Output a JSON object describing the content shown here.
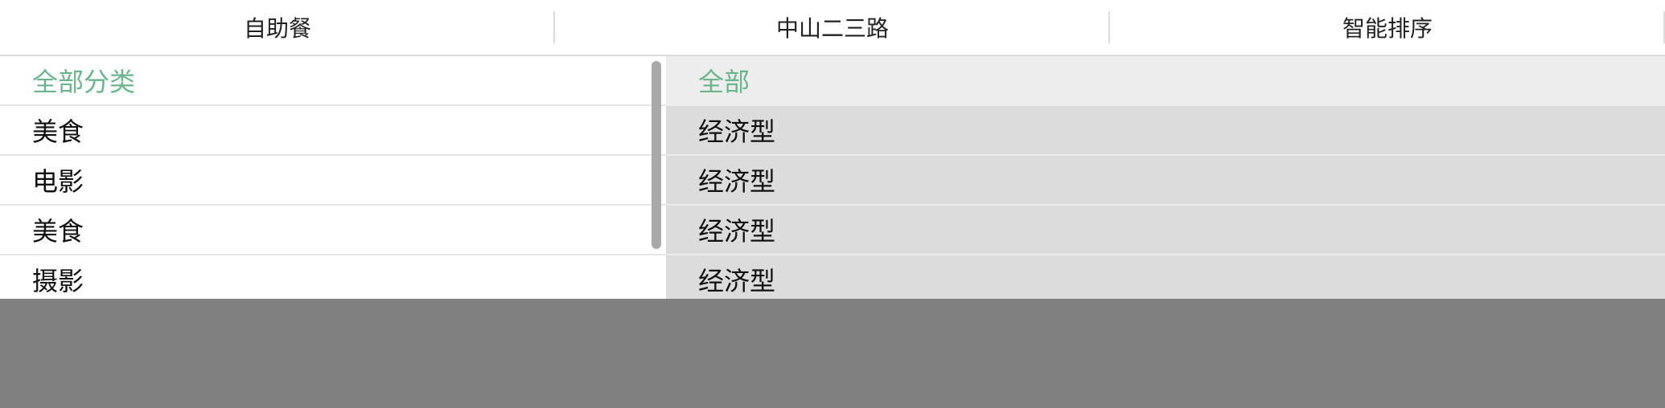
{
  "filter_bar": {
    "tabs": [
      {
        "label": "自助餐"
      },
      {
        "label": "中山二三路"
      },
      {
        "label": "智能排序"
      }
    ]
  },
  "category_list": {
    "items": [
      {
        "label": "全部分类",
        "selected": true
      },
      {
        "label": "美食",
        "selected": false
      },
      {
        "label": "电影",
        "selected": false
      },
      {
        "label": "美食",
        "selected": false
      },
      {
        "label": "摄影",
        "selected": false
      }
    ]
  },
  "subcategory_list": {
    "items": [
      {
        "label": "全部",
        "selected": true
      },
      {
        "label": "经济型",
        "selected": false
      },
      {
        "label": "经济型",
        "selected": false
      },
      {
        "label": "经济型",
        "selected": false
      },
      {
        "label": "经济型",
        "selected": false
      }
    ]
  },
  "colors": {
    "accent": "#6cb48e",
    "overlay": "#808080",
    "right_panel_bg": "#dcdcdc"
  }
}
